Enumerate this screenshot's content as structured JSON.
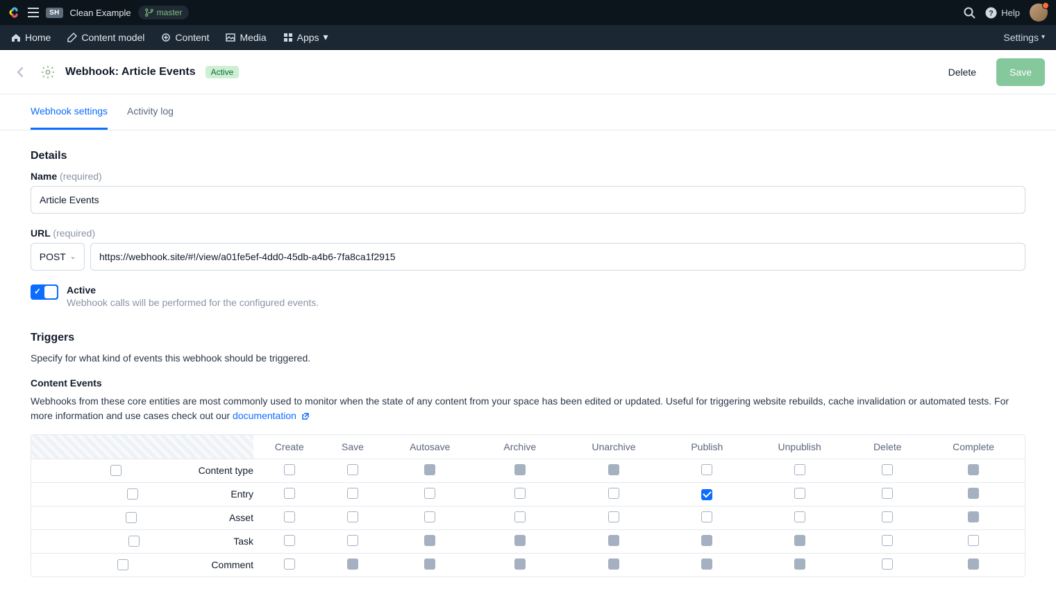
{
  "topbar": {
    "space_badge": "SH",
    "space_name": "Clean Example",
    "branch": "master",
    "help_label": "Help"
  },
  "nav": {
    "home": "Home",
    "content_model": "Content model",
    "content": "Content",
    "media": "Media",
    "apps": "Apps",
    "settings": "Settings"
  },
  "header": {
    "title": "Webhook: Article Events",
    "status": "Active",
    "delete": "Delete",
    "save": "Save"
  },
  "tabs": {
    "settings": "Webhook settings",
    "activity": "Activity log"
  },
  "details": {
    "section": "Details",
    "name_label": "Name",
    "name_hint": "(required)",
    "name_value": "Article Events",
    "url_label": "URL",
    "url_hint": "(required)",
    "method": "POST",
    "url_value": "https://webhook.site/#!/view/a01fe5ef-4dd0-45db-a4b6-7fa8ca1f2915",
    "active_label": "Active",
    "active_desc": "Webhook calls will be performed for the configured events."
  },
  "triggers": {
    "section": "Triggers",
    "sub": "Specify for what kind of events this webhook should be triggered.",
    "ce_title": "Content Events",
    "ce_desc_a": "Webhooks from these core entities are most commonly used to monitor when the state of any content from your space has been edited or updated. Useful for triggering website rebuilds, cache invalidation or automated tests. For more information and use cases check out our ",
    "ce_link": "documentation",
    "columns": [
      "Create",
      "Save",
      "Autosave",
      "Archive",
      "Unarchive",
      "Publish",
      "Unpublish",
      "Delete",
      "Complete"
    ],
    "rows": [
      {
        "label": "Content type",
        "cells": [
          "u",
          "u",
          "d",
          "d",
          "d",
          "u",
          "u",
          "u",
          "d"
        ]
      },
      {
        "label": "Entry",
        "cells": [
          "u",
          "u",
          "u",
          "u",
          "u",
          "c",
          "u",
          "u",
          "d"
        ]
      },
      {
        "label": "Asset",
        "cells": [
          "u",
          "u",
          "u",
          "u",
          "u",
          "u",
          "u",
          "u",
          "d"
        ]
      },
      {
        "label": "Task",
        "cells": [
          "u",
          "u",
          "d",
          "d",
          "d",
          "d",
          "d",
          "u",
          "u"
        ]
      },
      {
        "label": "Comment",
        "cells": [
          "u",
          "d",
          "d",
          "d",
          "d",
          "d",
          "d",
          "u",
          "d"
        ]
      }
    ]
  }
}
